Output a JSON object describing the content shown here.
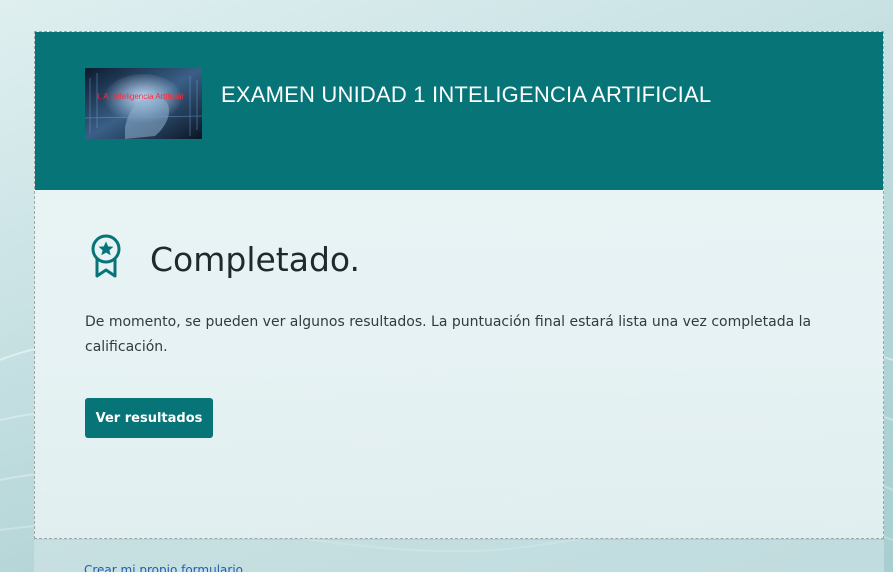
{
  "form": {
    "title": "EXAMEN UNIDAD 1 INTELIGENCIA ARTIFICIAL",
    "header_image_caption": "I. A. Inteligencia Artificial"
  },
  "result": {
    "heading": "Completado.",
    "message": "De momento, se pueden ver algunos resultados. La puntuación final estará lista una vez completada la calificación.",
    "button_label": "Ver resultados"
  },
  "footer": {
    "link_text": "Crear mi propio formulario"
  },
  "colors": {
    "accent": "#077578",
    "background": "#c9e2e4",
    "link": "#1f5eb5"
  },
  "icons": {
    "award": "award-ribbon-icon"
  }
}
